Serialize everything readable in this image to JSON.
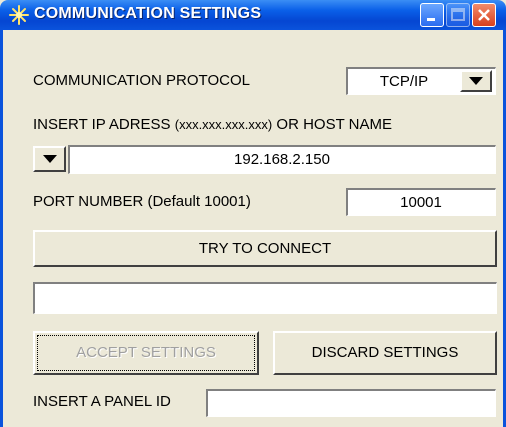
{
  "window": {
    "title": "COMMUNICATION SETTINGS",
    "icon": "sparkle-icon",
    "controls": [
      "minimize-icon",
      "maximize-icon",
      "close-icon"
    ]
  },
  "protocol": {
    "label": "COMMUNICATION PROTOCOL",
    "value": "TCP/IP"
  },
  "ip": {
    "label": "INSERT IP ADRESS",
    "format_hint": "(xxx.xxx.xxx.xxx)",
    "label_suffix": "OR  HOST  NAME",
    "value": "192.168.2.150"
  },
  "port": {
    "label": "PORT NUMBER (Default 10001)",
    "value": "10001"
  },
  "buttons": {
    "connect": "TRY TO CONNECT",
    "accept": "ACCEPT SETTINGS",
    "discard": "DISCARD SETTINGS"
  },
  "status": {
    "value": ""
  },
  "panel": {
    "label": "INSERT A PANEL ID",
    "value": ""
  },
  "colors": {
    "titlebar": "#0A5FE8",
    "background": "#ECE9D8",
    "close_button": "#D8401E"
  }
}
